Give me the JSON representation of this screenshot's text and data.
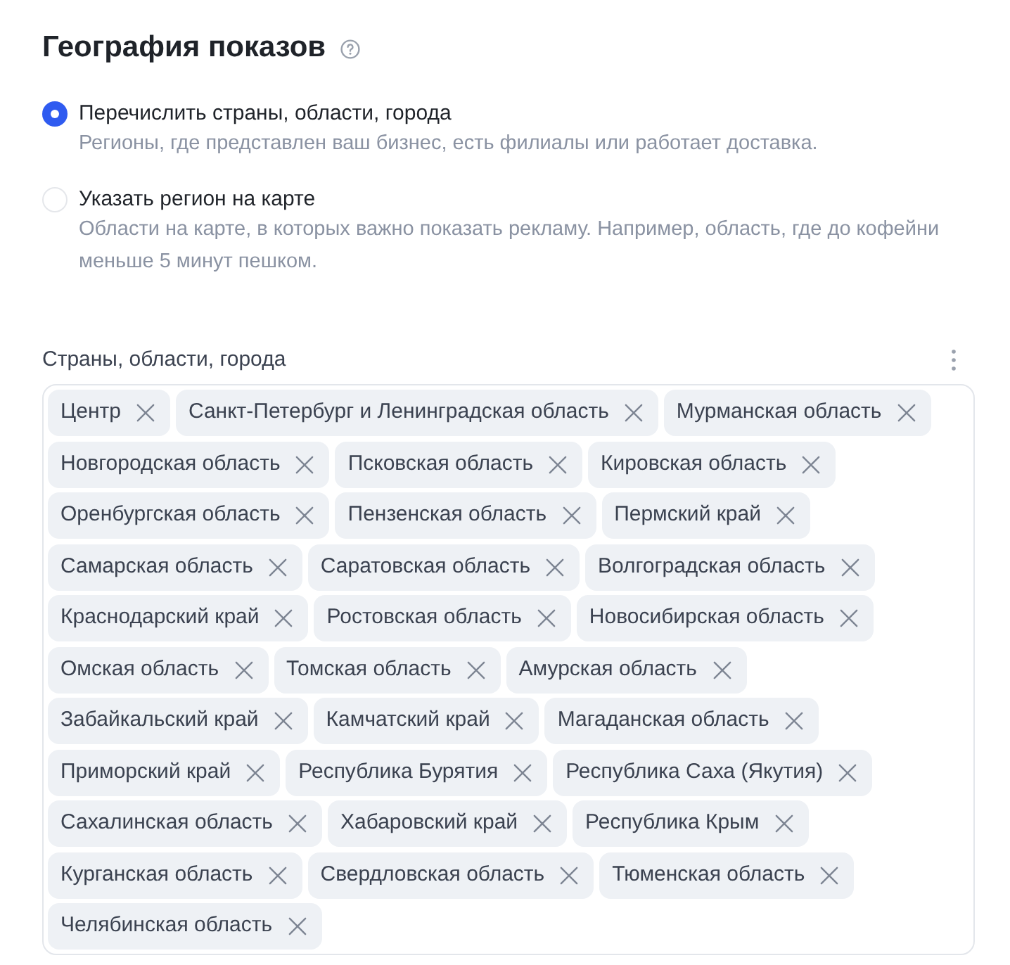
{
  "section": {
    "title": "География показов"
  },
  "options": [
    {
      "label": "Перечислить страны, области, города",
      "description": "Регионы, где представлен ваш бизнес, есть филиалы или работает доставка.",
      "selected": true
    },
    {
      "label": "Указать регион на карте",
      "description": "Области на карте, в которых важно показать рекламу. Например, область, где до кофейни меньше 5 минут пешком.",
      "selected": false
    }
  ],
  "regions_field": {
    "label": "Страны, области, города",
    "tags": [
      "Центр",
      "Санкт-Петербург и Ленинградская область",
      "Мурманская область",
      "Новгородская область",
      "Псковская область",
      "Кировская область",
      "Оренбургская область",
      "Пензенская область",
      "Пермский край",
      "Самарская область",
      "Саратовская область",
      "Волгоградская область",
      "Краснодарский край",
      "Ростовская область",
      "Новосибирская область",
      "Омская область",
      "Томская область",
      "Амурская область",
      "Забайкальский край",
      "Камчатский край",
      "Магаданская область",
      "Приморский край",
      "Республика Бурятия",
      "Республика Саха (Якутия)",
      "Сахалинская область",
      "Хабаровский край",
      "Республика Крым",
      "Курганская область",
      "Свердловская область",
      "Тюменская область",
      "Челябинская область"
    ]
  }
}
